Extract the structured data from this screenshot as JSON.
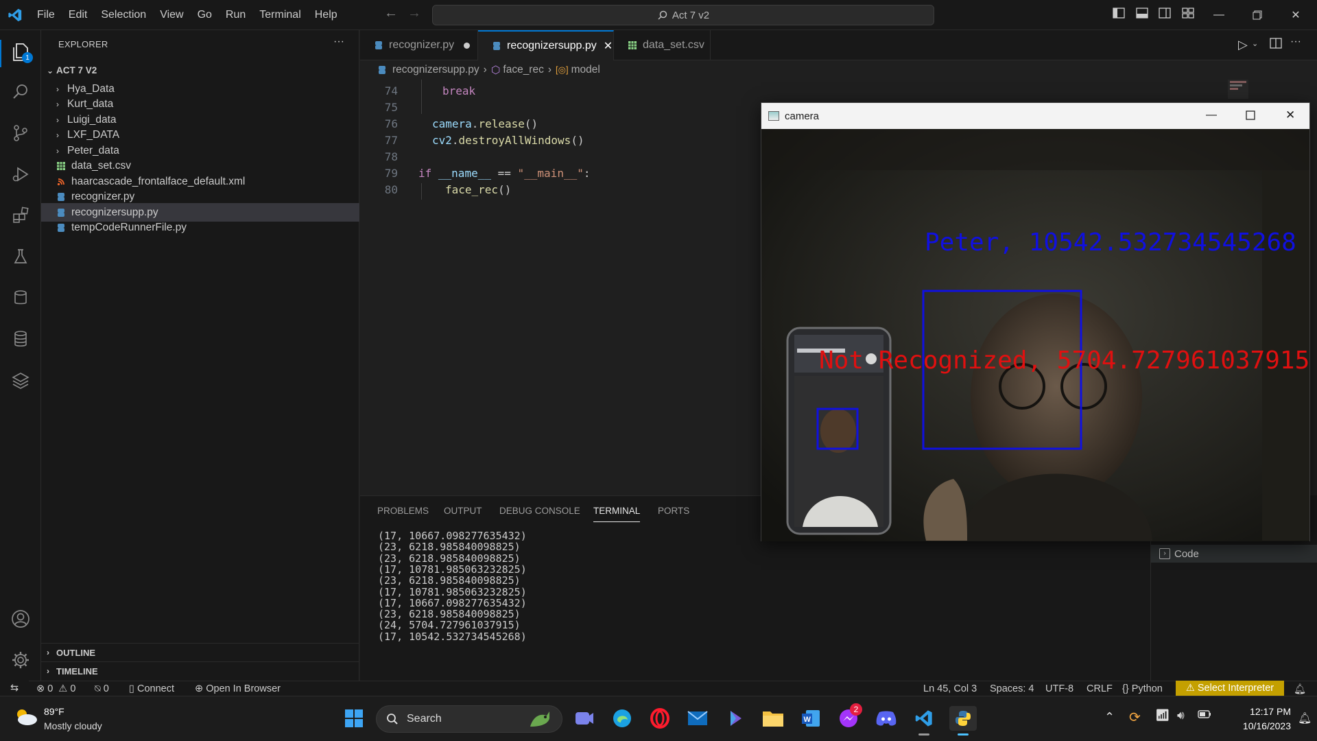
{
  "window": {
    "search_text": "Act 7 v2"
  },
  "menu": [
    "File",
    "Edit",
    "Selection",
    "View",
    "Go",
    "Run",
    "Terminal",
    "Help"
  ],
  "explorer": {
    "title": "EXPLORER",
    "more": "···",
    "root": "ACT 7 V2",
    "items": [
      {
        "label": "Hya_Data",
        "type": "folder"
      },
      {
        "label": "Kurt_data",
        "type": "folder"
      },
      {
        "label": "Luigi_data",
        "type": "folder"
      },
      {
        "label": "LXF_DATA",
        "type": "folder"
      },
      {
        "label": "Peter_data",
        "type": "folder"
      },
      {
        "label": "data_set.csv",
        "type": "csv"
      },
      {
        "label": "haarcascade_frontalface_default.xml",
        "type": "xml"
      },
      {
        "label": "recognizer.py",
        "type": "py"
      },
      {
        "label": "recognizersupp.py",
        "type": "py",
        "selected": true
      },
      {
        "label": "tempCodeRunnerFile.py",
        "type": "py"
      }
    ],
    "outline": "OUTLINE",
    "timeline": "TIMELINE"
  },
  "badge_count": "1",
  "tabs": [
    {
      "label": "recognizer.py",
      "modified": true
    },
    {
      "label": "recognizersupp.py",
      "active": true,
      "close": "✕"
    },
    {
      "label": "data_set.csv"
    }
  ],
  "breadcrumbs": [
    "recognizersupp.py",
    "face_rec",
    "model"
  ],
  "editor": {
    "line_numbers": [
      "74",
      "75",
      "76",
      "77",
      "78",
      "79",
      "80"
    ]
  },
  "panel": {
    "tabs": [
      "PROBLEMS",
      "OUTPUT",
      "DEBUG CONSOLE",
      "TERMINAL",
      "PORTS"
    ],
    "active_tab": "TERMINAL",
    "terminal_lines": [
      "(17, 10667.098277635432)",
      "(23, 6218.985840098825)",
      "(23, 6218.985840098825)",
      "(17, 10781.985063232825)",
      "(23, 6218.985840098825)",
      "(17, 10781.985063232825)",
      "(17, 10667.098277635432)",
      "(23, 6218.985840098825)",
      "(24, 5704.727961037915)",
      "(17, 10542.532734545268)"
    ],
    "right_label": "Code"
  },
  "camera": {
    "title": "camera",
    "label_peter": "Peter, 10542.532734545268",
    "label_not": "Not Recognized, 5704.727961037915",
    "label_peter_color": "#1010e0",
    "label_not_color": "#e01010"
  },
  "status": {
    "errors": "0",
    "warnings": "0",
    "ports": "0",
    "connect": "Connect",
    "open_browser": "Open In Browser",
    "position": "Ln 45, Col 3",
    "spaces": "Spaces: 4",
    "encoding": "UTF-8",
    "eol": "CRLF",
    "language": "Python",
    "interpreter": "Select Interpreter",
    "interpreter_bg": "#c4a000"
  },
  "taskbar": {
    "temp": "89°F",
    "weather": "Mostly cloudy",
    "search": "Search",
    "messenger_badge": "2",
    "time": "12:17 PM",
    "date": "10/16/2023"
  }
}
